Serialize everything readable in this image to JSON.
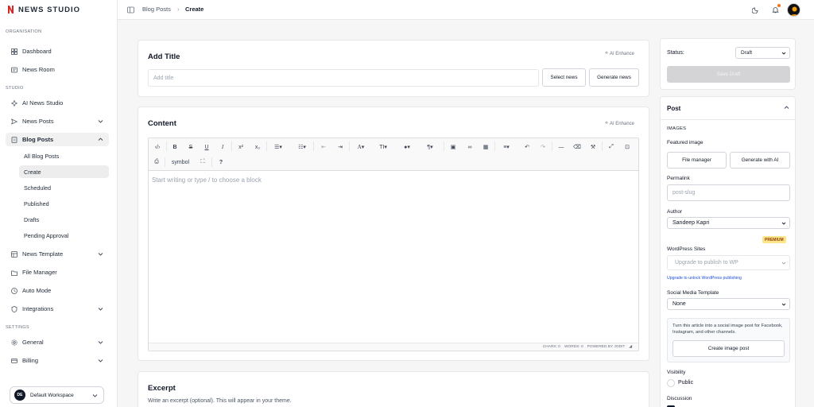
{
  "brand": {
    "name": "NEWS STUDIO",
    "accent": "#dc2626"
  },
  "sidebar": {
    "sections": {
      "organisation": "ORGANISATION",
      "studio": "STUDIO",
      "settings": "SETTINGS"
    },
    "items": {
      "dashboard": "Dashboard",
      "news_room": "News Room",
      "ai_news_studio": "AI News Studio",
      "news_posts": "News Posts",
      "blog_posts": "Blog Posts",
      "news_template": "News Template",
      "file_manager": "File Manager",
      "auto_mode": "Auto Mode",
      "integrations": "Integrations",
      "general": "General",
      "billing": "Billing"
    },
    "blog_sub": [
      "All Blog Posts",
      "Create",
      "Scheduled",
      "Published",
      "Drafts",
      "Pending Approval"
    ],
    "workspace": {
      "initials": "DE",
      "name": "Default Workspace"
    }
  },
  "topbar": {
    "breadcrumb": [
      "Blog Posts",
      "Create"
    ]
  },
  "title_card": {
    "heading": "Add Title",
    "ai_enhance": "AI Enhance",
    "placeholder": "Add title",
    "select_news": "Select news",
    "generate_news": "Generate news"
  },
  "content_card": {
    "heading": "Content",
    "ai_enhance": "AI Enhance",
    "placeholder": "Start writing or type / to choose a block",
    "toolbar_symbol": "symbol",
    "toolbar_help": "?",
    "status": {
      "chars": "CHARS: 0",
      "words": "WORDS: 0",
      "powered": "POWERED BY JODIT"
    }
  },
  "excerpt_card": {
    "heading": "Excerpt",
    "hint": "Write an excerpt (optional). This will appear in your theme."
  },
  "status_panel": {
    "label": "Status:",
    "value": "Draft",
    "save_label": "Save Draft"
  },
  "post_panel": {
    "heading": "Post",
    "images_label": "IMAGES",
    "featured_label": "Featured image",
    "file_manager_btn": "File manager",
    "generate_ai_btn": "Generate with AI",
    "permalink_label": "Permalink",
    "permalink_placeholder": "post-slug",
    "author_label": "Author",
    "author_value": "Sandeep Kapri",
    "premium_badge": "PREMIUM",
    "wp_label": "WordPress Sites",
    "wp_placeholder": "Upgrade to publish to WP",
    "wp_link": "Upgrade to unlock WordPress publishing",
    "social_label": "Social Media Template",
    "social_value": "None",
    "social_hint": "Turn this article into a social image post for Facebook, Instagram, and other channels.",
    "create_image_btn": "Create image post",
    "visibility_label": "Visibility",
    "visibility_value": "Public",
    "discussion_label": "Discussion"
  }
}
